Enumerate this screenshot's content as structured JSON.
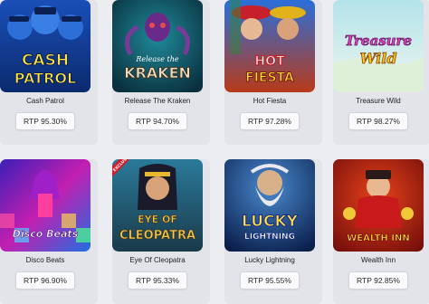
{
  "games": [
    {
      "name": "Cash Patrol",
      "rtp": "RTP 95.30%",
      "logo": [
        "CASH",
        "PATROL"
      ]
    },
    {
      "name": "Release The Kraken",
      "rtp": "RTP 94.70%",
      "logo": [
        "Release the",
        "KRAKEN"
      ]
    },
    {
      "name": "Hot Fiesta",
      "rtp": "RTP 97.28%",
      "logo": [
        "HOT",
        "FIESTA"
      ]
    },
    {
      "name": "Treasure Wild",
      "rtp": "RTP 98.27%",
      "logo": [
        "Treasure",
        "Wild"
      ]
    },
    {
      "name": "Disco Beats",
      "rtp": "RTP 96.90%",
      "logo": [
        "Disco Beats"
      ]
    },
    {
      "name": "Eye Of Cleopatra",
      "rtp": "RTP 95.33%",
      "logo": [
        "EYE OF",
        "CLEOPATRA"
      ],
      "ribbon": "EXCLUSIVE"
    },
    {
      "name": "Lucky Lightning",
      "rtp": "RTP 95.55%",
      "logo": [
        "LUCKY",
        "LIGHTNING"
      ]
    },
    {
      "name": "Wealth Inn",
      "rtp": "RTP 92.85%",
      "logo": [
        "WEALTH INN"
      ]
    }
  ],
  "theme": {
    "page_bg": "#ecedf1",
    "card_bg": "#e2e4ea",
    "rtp_bg": "#fafafc"
  }
}
